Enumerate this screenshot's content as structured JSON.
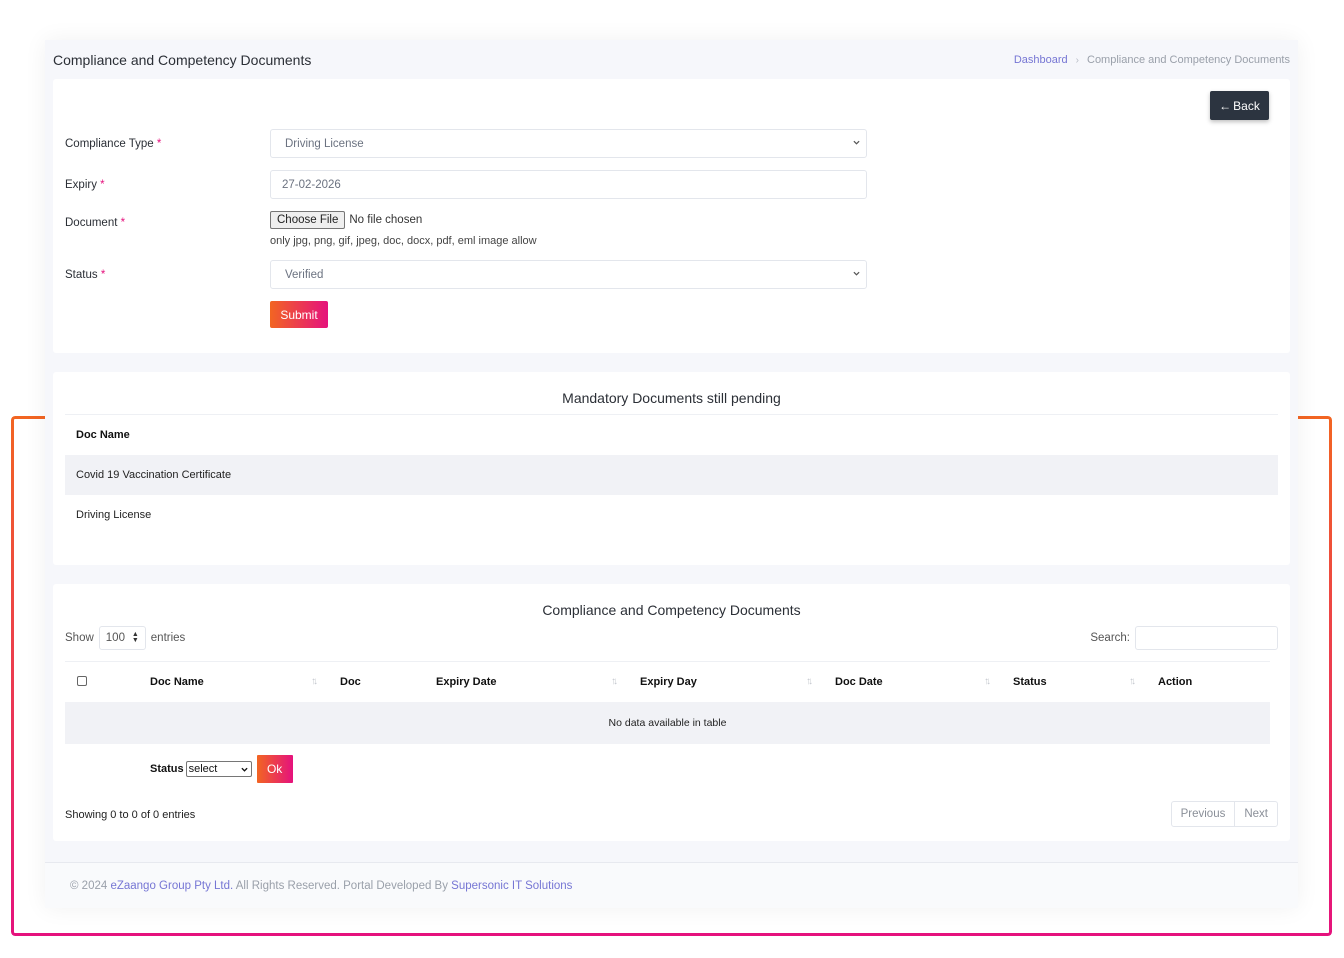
{
  "header": {
    "title": "Compliance and Competency Documents",
    "breadcrumb": [
      {
        "label": "Dashboard",
        "link": true
      },
      {
        "label": "Compliance and Competency Documents",
        "link": false
      }
    ],
    "breadcrumb_separator": "›"
  },
  "form": {
    "back_label": "Back",
    "back_icon": "arrow-left-icon",
    "fields": {
      "compliance_type": {
        "label": "Compliance Type",
        "required_mark": "*",
        "value": "Driving License"
      },
      "expiry": {
        "label": "Expiry",
        "required_mark": "*",
        "value": "27-02-2026"
      },
      "document": {
        "label": "Document",
        "required_mark": "*",
        "choose_label": "Choose File",
        "file_status": "No file chosen",
        "hint": "only jpg, png, gif, jpeg, doc, docx, pdf, eml image allow"
      },
      "status": {
        "label": "Status",
        "required_mark": "*",
        "value": "Verified"
      }
    },
    "submit_label": "Submit"
  },
  "pending": {
    "title": "Mandatory Documents still pending",
    "column": "Doc Name",
    "rows": [
      "Covid 19 Vaccination Certificate",
      "Driving License"
    ]
  },
  "documents": {
    "title": "Compliance and Competency Documents",
    "show_label": "Show",
    "page_length": "100",
    "entries_label": "entries",
    "search_label": "Search:",
    "search_value": "",
    "columns": [
      "Doc Name",
      "Doc",
      "Expiry Date",
      "Expiry Day",
      "Doc Date",
      "Status",
      "Action"
    ],
    "empty_message": "No data available in table",
    "bulk_status_label": "Status",
    "bulk_status_value": "select",
    "ok_label": "Ok",
    "info": "Showing 0 to 0 of 0 entries",
    "prev_label": "Previous",
    "next_label": "Next"
  },
  "footer": {
    "prefix": "© 2024 ",
    "company": "eZaango Group Pty Ltd.",
    "middle": " All Rights Reserved. Portal Developed By ",
    "developer": "Supersonic IT Solutions"
  },
  "colors": {
    "accent_start": "#f26522",
    "accent_end": "#e5127d",
    "link": "#7676d4",
    "dark_button": "#2c3440"
  }
}
